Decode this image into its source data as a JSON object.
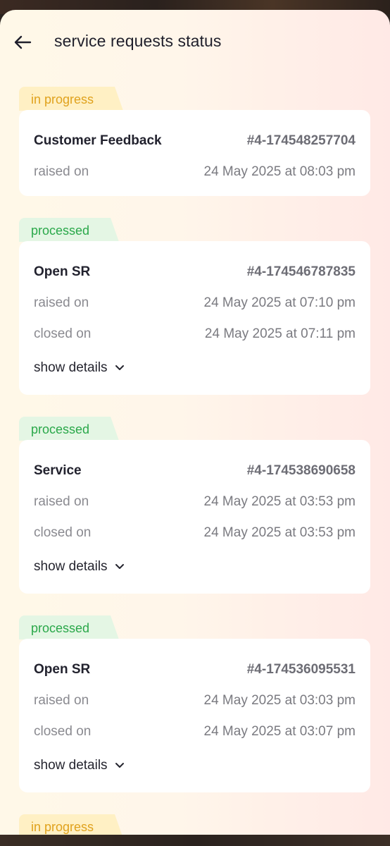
{
  "header": {
    "title": "service requests status"
  },
  "requests": [
    {
      "status": "in progress",
      "name": "Customer Feedback",
      "id": "#4-174548257704",
      "raised_label": "raised on",
      "raised_on": "24 May 2025 at 08:03 pm"
    },
    {
      "status": "processed",
      "name": "Open SR",
      "id": "#4-174546787835",
      "raised_label": "raised on",
      "raised_on": "24 May 2025 at 07:10 pm",
      "closed_label": "closed on",
      "closed_on": "24 May 2025 at 07:11 pm",
      "details_label": "show details"
    },
    {
      "status": "processed",
      "name": "Service",
      "id": "#4-174538690658",
      "raised_label": "raised on",
      "raised_on": "24 May 2025 at 03:53 pm",
      "closed_label": "closed on",
      "closed_on": "24 May 2025 at 03:53 pm",
      "details_label": "show details"
    },
    {
      "status": "processed",
      "name": "Open SR",
      "id": "#4-174536095531",
      "raised_label": "raised on",
      "raised_on": "24 May 2025 at 03:03 pm",
      "closed_label": "closed on",
      "closed_on": "24 May 2025 at 03:07 pm",
      "details_label": "show details"
    },
    {
      "status": "in progress"
    }
  ],
  "colors": {
    "in_progress_bg": "#fff0c4",
    "in_progress_text": "#e0a21d",
    "processed_bg": "#e4f6e4",
    "processed_text": "#2aa84a"
  },
  "icons": {
    "back": "arrow-left-icon",
    "expand": "chevron-down-icon"
  }
}
